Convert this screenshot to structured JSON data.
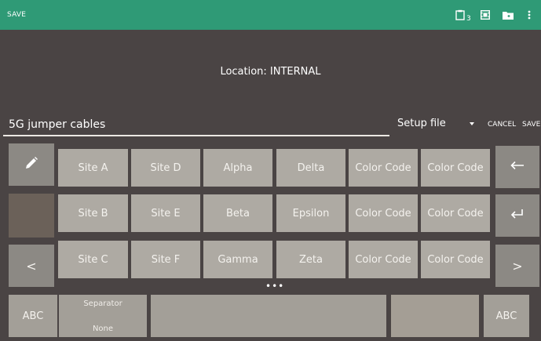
{
  "toolbar": {
    "title": "SAVE",
    "clipboard_count": "3",
    "icons": [
      "clipboard-icon",
      "film-icon",
      "folder-icon",
      "more-vert-icon"
    ]
  },
  "location": "Location: INTERNAL",
  "file": {
    "name": "5G jumper cables",
    "type": "Setup file",
    "cancel": "CANCEL",
    "save": "SAVE"
  },
  "keys": {
    "row1": [
      "Site A",
      "Site D",
      "Alpha",
      "Delta",
      "Color Code",
      "Color Code"
    ],
    "row2": [
      "Site B",
      "Site E",
      "Beta",
      "Epsilon",
      "Color Code",
      "Color Code"
    ],
    "row3": [
      "Site C",
      "Site F",
      "Gamma",
      "Zeta",
      "Color Code",
      "Color Code"
    ]
  },
  "bottom": {
    "abc_left": "ABC",
    "separator_label": "Separator",
    "separator_value": "None",
    "abc_right": "ABC",
    "prev": "<",
    "next": ">"
  },
  "colors": {
    "accent": "#2f9a76",
    "background": "#4a4444",
    "key": "#aeaaa3"
  }
}
